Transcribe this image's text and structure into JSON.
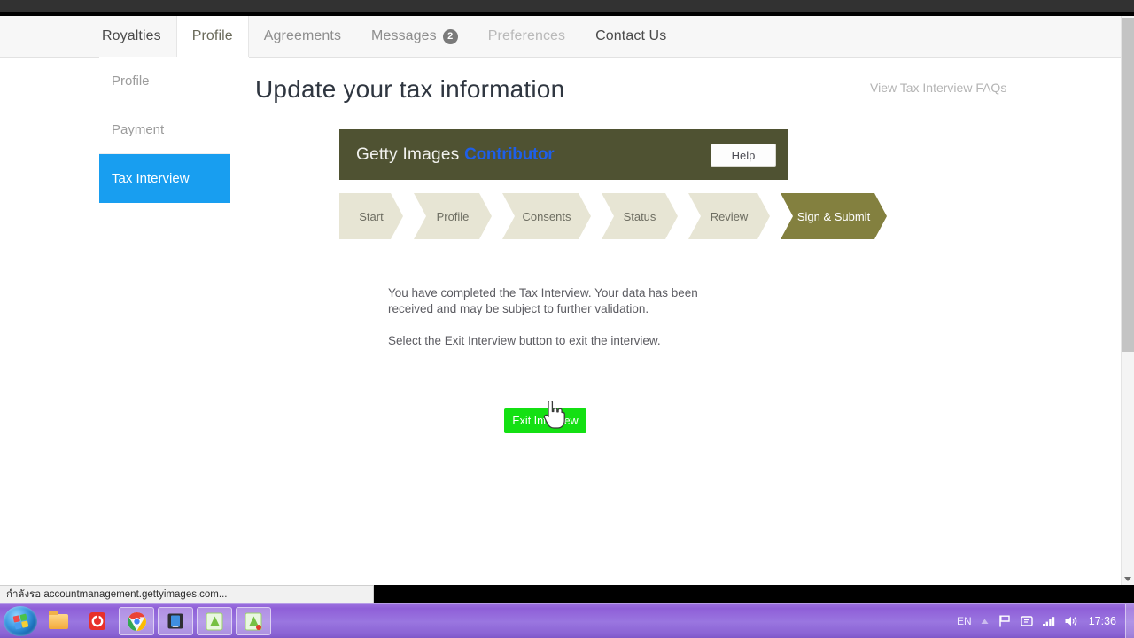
{
  "browser": {
    "status_text": "กำลังรอ accountmanagement.gettyimages.com..."
  },
  "topnav": {
    "items": [
      {
        "label": "Royalties",
        "state": "strong",
        "badge": null
      },
      {
        "label": "Profile",
        "state": "active",
        "badge": null
      },
      {
        "label": "Agreements",
        "state": "medium",
        "badge": null
      },
      {
        "label": "Messages",
        "state": "medium",
        "badge": "2"
      },
      {
        "label": "Preferences",
        "state": "light",
        "badge": null
      },
      {
        "label": "Contact Us",
        "state": "strong",
        "badge": null
      }
    ]
  },
  "sidebar": {
    "items": [
      {
        "label": "Profile",
        "selected": false
      },
      {
        "label": "Payment",
        "selected": false
      },
      {
        "label": "Tax Interview",
        "selected": true
      }
    ]
  },
  "main": {
    "page_title": "Update your tax information",
    "faq_link": "View Tax Interview FAQs",
    "widget": {
      "brand_prefix": "Getty Images ",
      "brand_suffix": "Contributor",
      "help_label": "Help"
    },
    "steps": [
      {
        "label": "Start",
        "current": false
      },
      {
        "label": "Profile",
        "current": false
      },
      {
        "label": "Consents",
        "current": false
      },
      {
        "label": "Status",
        "current": false
      },
      {
        "label": "Review",
        "current": false
      },
      {
        "label": "Sign & Submit",
        "current": true
      }
    ],
    "paragraph_1": "You have completed the Tax Interview. Your data has been received and may be subject to further validation.",
    "paragraph_2": "Select the Exit Interview button to exit the interview.",
    "exit_button_label": "Exit Interview"
  },
  "taskbar": {
    "buttons": [
      {
        "name": "start-orb",
        "icon": "windows-logo-icon"
      },
      {
        "name": "explorer",
        "icon": "folder-icon"
      },
      {
        "name": "app-red",
        "icon": "red-app-icon"
      },
      {
        "name": "chrome",
        "icon": "chrome-icon"
      },
      {
        "name": "window-blue",
        "icon": "blue-window-icon"
      },
      {
        "name": "app-green-1",
        "icon": "green-doc-icon"
      },
      {
        "name": "app-green-2",
        "icon": "green-doc-icon"
      }
    ],
    "tray": {
      "language": "EN",
      "clock": "17:36",
      "icons": [
        "show-hidden-icons",
        "flag-icon",
        "action-center-icon",
        "network-icon",
        "volume-icon"
      ]
    }
  },
  "colors": {
    "accent_blue": "#189ef0",
    "olive_header": "#4f5232",
    "olive_active_step": "#83803f",
    "step_bg": "#e7e5d4",
    "exit_green": "#14e013",
    "taskbar_purple": "#9a76e0",
    "contributor_blue": "#1f5fe8"
  }
}
